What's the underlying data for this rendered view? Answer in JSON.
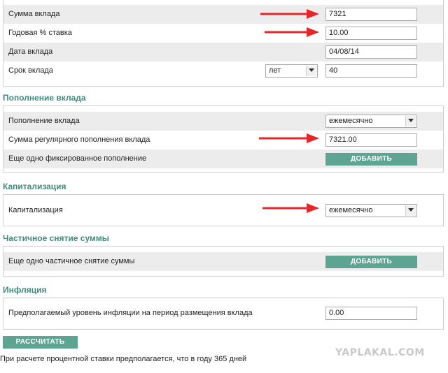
{
  "deposit": {
    "amount_label": "Сумма вклада",
    "amount_value": "7321",
    "rate_label": "Годовая % ставка",
    "rate_value": "10.00",
    "date_label": "Дата вклада",
    "date_value": "04/08/14",
    "term_label": "Срок вклада",
    "term_unit": "лет",
    "term_value": "40"
  },
  "replenish": {
    "title": "Пополнение вклада",
    "freq_label": "Пополнение вклада",
    "freq_value": "ежемесячно",
    "regular_label": "Сумма регулярного пополнения вклада",
    "regular_value": "7321.00",
    "fixed_label": "Еще одно фиксированное пополнение",
    "add_label": "ДОБАВИТЬ"
  },
  "capitalization": {
    "title": "Капитализация",
    "label": "Капитализация",
    "value": "ежемесячно"
  },
  "withdrawal": {
    "title": "Частичное снятие суммы",
    "label": "Еще одно частичное снятие суммы",
    "add_label": "ДОБАВИТЬ"
  },
  "inflation": {
    "title": "Инфляция",
    "label": "Предполагаемый уровень инфляции на период размещения вклада",
    "value": "0.00"
  },
  "calculate_label": "РАССЧИТАТЬ",
  "note": "При расчете процентной ставки предполагается, что в году 365 дней",
  "watermark": "YAPLAKAL.COM",
  "colors": {
    "accent": "#5ea493",
    "heading": "#3f8a7d",
    "arrow": "#e8262a",
    "row_shade": "#ececec"
  }
}
